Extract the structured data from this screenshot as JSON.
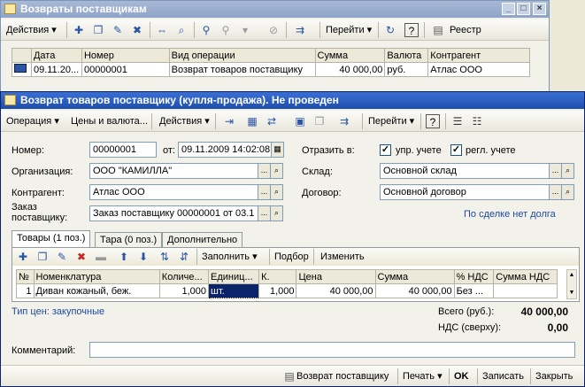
{
  "list_window": {
    "title": "Возвраты поставщикам",
    "actions_label": "Действия",
    "goto_label": "Перейти",
    "registry_label": "Реестр",
    "columns": [
      "Дата",
      "Номер",
      "Вид операции",
      "Сумма",
      "Валюта",
      "Контрагент"
    ],
    "row": {
      "date": "09.11.20...",
      "number": "00000001",
      "operation": "Возврат товаров поставщику",
      "sum": "40 000,00",
      "currency": "руб.",
      "counterparty": "Атлас ООО"
    }
  },
  "doc_window": {
    "title": "Возврат товаров поставщику (купля-продажа). Не проведен",
    "toolbar": {
      "operation": "Операция",
      "prices": "Цены и валюта...",
      "actions": "Действия",
      "goto": "Перейти"
    },
    "fields": {
      "number_label": "Номер:",
      "number": "00000001",
      "from_label": "от:",
      "date": "09.11.2009 14:02:08",
      "reflect_label": "Отразить в:",
      "mgmt_label": "упр. учете",
      "reg_label": "регл. учете",
      "org_label": "Организация:",
      "org": "ООО \"КАМИЛЛА\"",
      "warehouse_label": "Склад:",
      "warehouse": "Основной склад",
      "counterparty_label": "Контрагент:",
      "counterparty": "Атлас ООО",
      "contract_label": "Договор:",
      "contract": "Основной договор",
      "order_label_1": "Заказ",
      "order_label_2": "поставщику:",
      "order": "Заказ поставщику 00000001 от 03.1",
      "debt_link": "По сделке нет долга"
    },
    "tabs": [
      "Товары (1 поз.)",
      "Тара (0 поз.)",
      "Дополнительно"
    ],
    "goods_toolbar": {
      "fill": "Заполнить",
      "pick": "Подбор",
      "change": "Изменить"
    },
    "columns": [
      "№",
      "Номенклатура",
      "Количе...",
      "Единиц...",
      "К.",
      "Цена",
      "Сумма",
      "% НДС",
      "Сумма НДС"
    ],
    "row": {
      "n": "1",
      "name": "Диван кожаный, беж.",
      "qty": "1,000",
      "unit": "шт.",
      "k": "1,000",
      "price": "40 000,00",
      "sum": "40 000,00",
      "vat": "Без ...",
      "vat_sum": ""
    },
    "price_type": "Тип цен: закупочные",
    "total_label": "Всего (руб.):",
    "total": "40 000,00",
    "vat_label": "НДС (сверху):",
    "vat": "0,00",
    "comment_label": "Комментарий:",
    "bottom": {
      "return": "Возврат поставщику",
      "print": "Печать",
      "ok": "OK",
      "save": "Записать",
      "close": "Закрыть"
    }
  }
}
